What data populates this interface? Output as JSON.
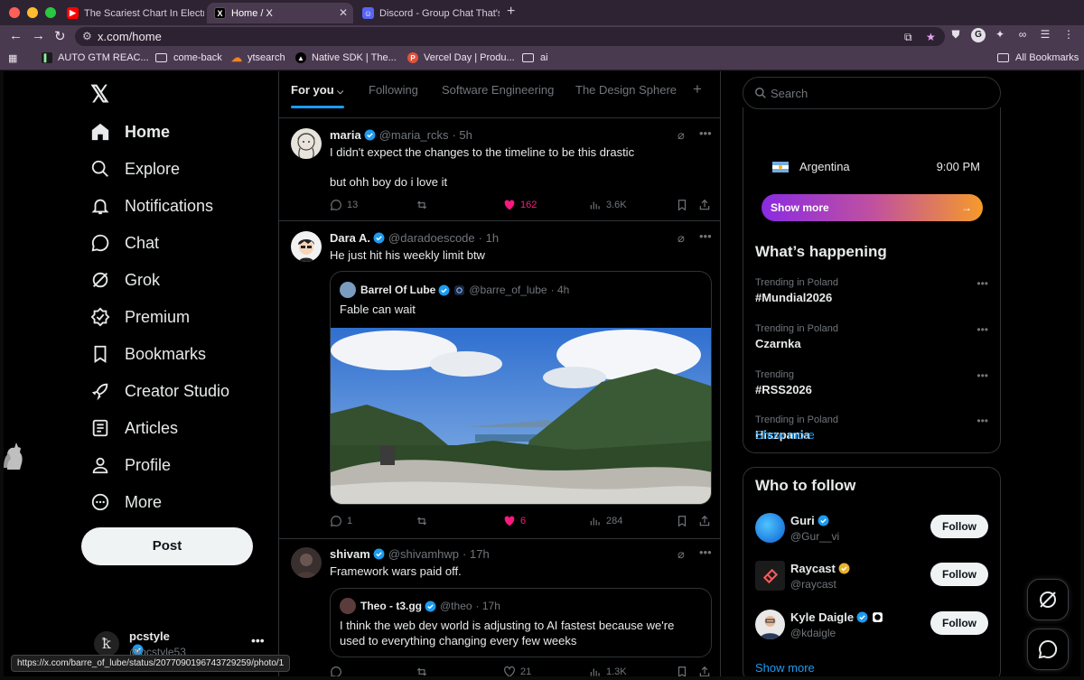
{
  "browser": {
    "tabs": [
      {
        "title": "The Scariest Chart In Electric",
        "favicon": "youtube-icon"
      },
      {
        "title": "Home / X",
        "favicon": "x-icon"
      },
      {
        "title": "Discord - Group Chat That's",
        "favicon": "discord-icon"
      }
    ],
    "url": "x.com/home",
    "bookmarks": [
      {
        "label": "AUTO GTM REAC...",
        "icon": "app-icon"
      },
      {
        "label": "come-back",
        "icon": "folder-icon"
      },
      {
        "label": "ytsearch",
        "icon": "cloud-icon"
      },
      {
        "label": "Native SDK | The...",
        "icon": "triangle-icon"
      },
      {
        "label": "Vercel Day | Produ...",
        "icon": "p-icon"
      },
      {
        "label": "ai",
        "icon": "folder-icon"
      }
    ],
    "all_bookmarks": "All Bookmarks",
    "status_url": "https://x.com/barre_of_lube/status/2077090196743729259/photo/1"
  },
  "nav": {
    "items": [
      {
        "label": "Home",
        "icon": "home-icon"
      },
      {
        "label": "Explore",
        "icon": "search-icon"
      },
      {
        "label": "Notifications",
        "icon": "bell-icon"
      },
      {
        "label": "Chat",
        "icon": "chat-icon"
      },
      {
        "label": "Grok",
        "icon": "grok-icon"
      },
      {
        "label": "Premium",
        "icon": "premium-icon"
      },
      {
        "label": "Bookmarks",
        "icon": "bookmark-icon"
      },
      {
        "label": "Creator Studio",
        "icon": "rocket-icon"
      },
      {
        "label": "Articles",
        "icon": "article-icon"
      },
      {
        "label": "Profile",
        "icon": "profile-icon"
      },
      {
        "label": "More",
        "icon": "more-icon"
      }
    ],
    "post": "Post",
    "account": {
      "name": "pcstyle",
      "handle": "@pcstyle53"
    }
  },
  "feed": {
    "tabs": [
      "For you",
      "Following",
      "Software Engineering",
      "The Design Sphere"
    ],
    "tweets": [
      {
        "name": "maria",
        "handle": "@maria_rcks",
        "time": "· 5h",
        "text1": "I didn't expect the changes to the timeline to be this drastic",
        "text2": "but ohh boy do i love it",
        "replies": "13",
        "retweets": "",
        "likes": "162",
        "views": "3.6K"
      },
      {
        "name": "Dara A.",
        "handle": "@daradoescode",
        "time": "· 1h",
        "text1": "He just hit his weekly limit btw",
        "quote": {
          "name": "Barrel Of Lube",
          "handle": "@barre_of_lube",
          "time": "· 4h",
          "text": "Fable can wait"
        },
        "replies": "1",
        "retweets": "",
        "likes": "6",
        "views": "284"
      },
      {
        "name": "shivam",
        "handle": "@shivamhwp",
        "time": "· 17h",
        "text1": "Framework wars paid off.",
        "quote": {
          "name": "Theo - t3.gg",
          "handle": "@theo",
          "time": "· 17h",
          "text": "I think the web dev world is adjusting to AI fastest because we're used to everything changing every few weeks"
        },
        "replies": "",
        "retweets": "",
        "likes": "21",
        "views": "1.3K"
      }
    ]
  },
  "right": {
    "search_placeholder": "Search",
    "timezone": {
      "country": "Argentina",
      "time": "9:00 PM"
    },
    "show_more_cta": "Show more",
    "whats_happening": "What’s happening",
    "trends": [
      {
        "context": "Trending in Poland",
        "topic": "#Mundial2026"
      },
      {
        "context": "Trending in Poland",
        "topic": "Czarnka"
      },
      {
        "context": "Trending",
        "topic": "#RSS2026"
      },
      {
        "context": "Trending in Poland",
        "topic": "Hiszpania"
      }
    ],
    "show_more": "Show more",
    "who_to_follow": "Who to follow",
    "follows": [
      {
        "name": "Guri",
        "handle": "@Gur__vi",
        "button": "Follow"
      },
      {
        "name": "Raycast",
        "handle": "@raycast",
        "button": "Follow"
      },
      {
        "name": "Kyle Daigle",
        "handle": "@kdaigle",
        "button": "Follow"
      }
    ],
    "show_more_2": "Show more"
  },
  "colors": {
    "accent": "#1d9bf0",
    "like": "#f91880",
    "background": "#000000"
  }
}
